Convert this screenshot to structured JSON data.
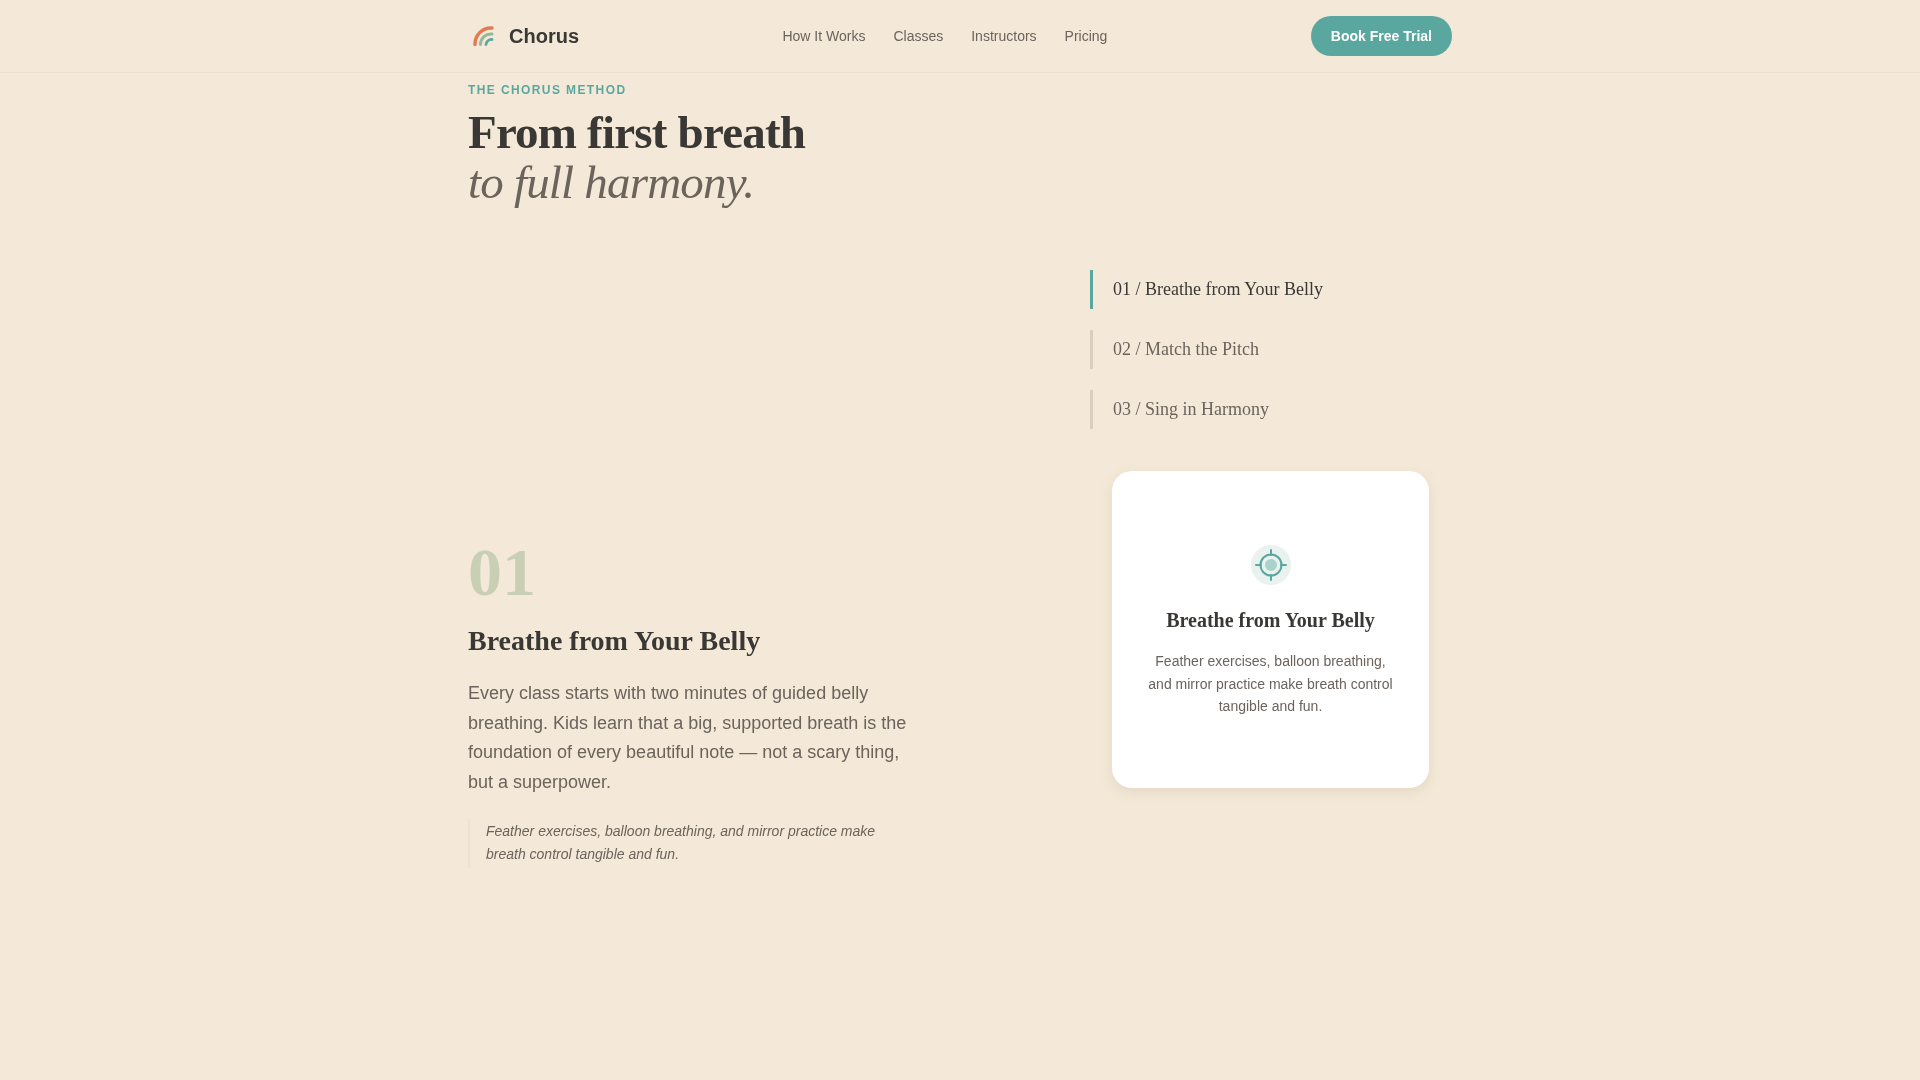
{
  "header": {
    "brand": "Chorus",
    "nav": [
      "How It Works",
      "Classes",
      "Instructors",
      "Pricing"
    ],
    "cta": "Book Free Trial"
  },
  "hero": {
    "eyebrow": "THE CHORUS METHOD",
    "title": "From first breath",
    "title_italic": "to full harmony."
  },
  "steps": [
    {
      "label": "01 / Breathe from Your Belly",
      "selected": true
    },
    {
      "label": "02 / Match the Pitch",
      "selected": false
    },
    {
      "label": "03 / Sing in Harmony",
      "selected": false
    }
  ],
  "detail": {
    "number": "01",
    "title": "Breathe from Your Belly",
    "body": "Every class starts with two minutes of guided belly breathing. Kids learn that a big, supported breath is the foundation of every beautiful note — not a scary thing, but a superpower.",
    "quote": "Feather exercises, balloon breathing, and mirror practice make breath control tangible and fun."
  },
  "card": {
    "title": "Breathe from Your Belly",
    "text": "Feather exercises, balloon breathing, and mirror practice make breath control tangible and fun."
  }
}
